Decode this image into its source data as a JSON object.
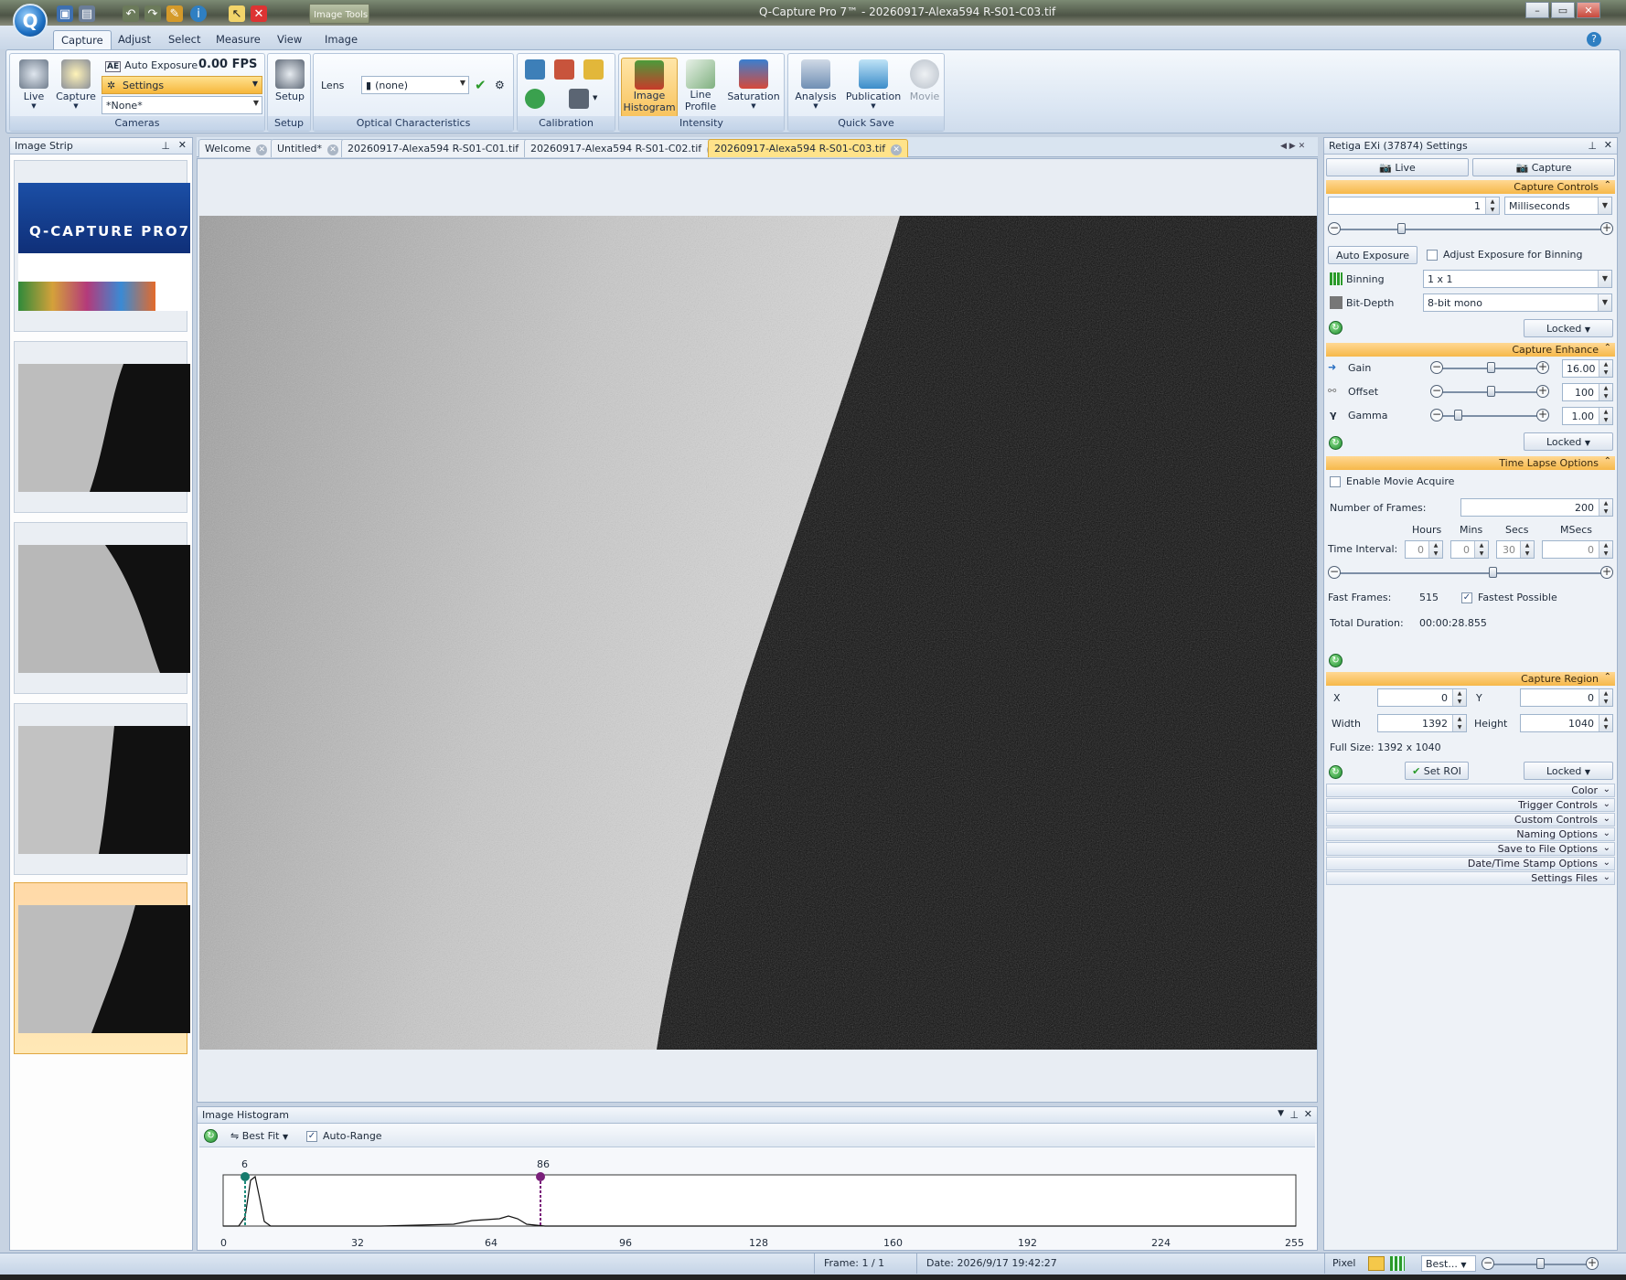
{
  "window": {
    "title": "Q-Capture Pro 7™ - 20260917-Alexa594 R-S01-C03.tif",
    "context_tab": "Image Tools"
  },
  "menu_tabs": [
    "Capture",
    "Adjust",
    "Select",
    "Measure",
    "View",
    "Image"
  ],
  "ribbon": {
    "cameras": {
      "live": "Live",
      "capture": "Capture",
      "auto_exposure": "Auto Exposure",
      "fps": "0.00 FPS",
      "settings": "Settings",
      "preset": "*None*",
      "label": "Cameras"
    },
    "setup": {
      "button": "Setup",
      "label": "Setup"
    },
    "optical": {
      "lens_label": "Lens",
      "lens_value": "(none)",
      "label": "Optical Characteristics"
    },
    "calibration": {
      "label": "Calibration"
    },
    "intensity": {
      "image_histogram": "Image Histogram",
      "line_profile": "Line Profile",
      "saturation": "Saturation",
      "label": "Intensity"
    },
    "quick_save": {
      "analysis": "Analysis",
      "publication": "Publication",
      "movie": "Movie",
      "label": "Quick Save"
    }
  },
  "image_strip": {
    "title": "Image Strip",
    "splash_title": "Q-CAPTURE PRO7"
  },
  "doc_tabs": [
    "Welcome",
    "Untitled*",
    "20260917-Alexa594 R-S01-C01.tif",
    "20260917-Alexa594 R-S01-C02.tif",
    "20260917-Alexa594 R-S01-C03.tif"
  ],
  "histogram": {
    "title": "Image Histogram",
    "best_fit": "Best Fit",
    "auto_range": "Auto-Range",
    "low_marker": "6",
    "high_marker": "86",
    "ticks": [
      "0",
      "32",
      "64",
      "96",
      "128",
      "160",
      "192",
      "224",
      "255"
    ]
  },
  "settings": {
    "title": "Retiga EXi (37874) Settings",
    "live_btn": "Live",
    "capture_btn": "Capture",
    "capture_controls": {
      "header": "Capture Controls",
      "exposure": "1",
      "unit": "Milliseconds",
      "auto_exposure": "Auto Exposure",
      "adjust_binning": "Adjust Exposure for Binning",
      "binning_label": "Binning",
      "binning": "1 x 1",
      "bitdepth_label": "Bit-Depth",
      "bitdepth": "8-bit mono",
      "locked": "Locked"
    },
    "capture_enhance": {
      "header": "Capture Enhance",
      "gain_label": "Gain",
      "gain": "16.00",
      "offset_label": "Offset",
      "offset": "100",
      "gamma_label": "Gamma",
      "gamma": "1.00",
      "locked": "Locked"
    },
    "time_lapse": {
      "header": "Time Lapse Options",
      "enable_movie": "Enable Movie Acquire",
      "frames_label": "Number of  Frames:",
      "frames": "200",
      "hours_h": "Hours",
      "mins_h": "Mins",
      "secs_h": "Secs",
      "msecs_h": "MSecs",
      "interval_label": "Time Interval:",
      "hours": "0",
      "mins": "0",
      "secs": "30",
      "msecs": "0",
      "fast_label": "Fast Frames:",
      "fast": "515",
      "fastest": "Fastest Possible",
      "duration_label": "Total Duration:",
      "duration": "00:00:28.855"
    },
    "capture_region": {
      "header": "Capture Region",
      "x_label": "X",
      "x": "0",
      "y_label": "Y",
      "y": "0",
      "w_label": "Width",
      "w": "1392",
      "h_label": "Height",
      "h": "1040",
      "full_size": "Full Size: 1392 x 1040",
      "set_roi": "Set ROI",
      "locked": "Locked"
    },
    "collapsed": [
      "Color",
      "Trigger Controls",
      "Custom Controls",
      "Naming Options",
      "Save to File Options",
      "Date/Time Stamp Options",
      "Settings Files"
    ]
  },
  "status": {
    "frame": "Frame: 1 / 1",
    "date": "Date: 2026/9/17 19:42:27",
    "pixel": "Pixel",
    "zoom": "Best..."
  }
}
